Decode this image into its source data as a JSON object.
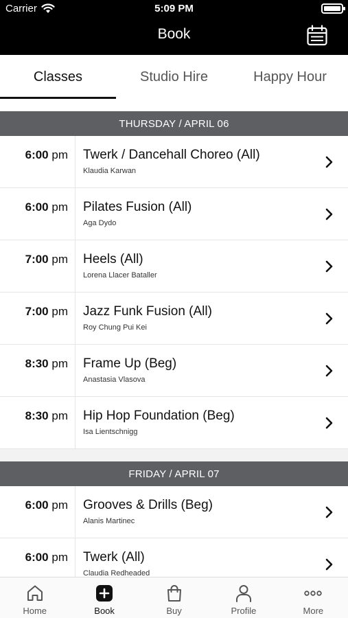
{
  "status_bar": {
    "carrier": "Carrier",
    "time": "5:09 PM"
  },
  "nav": {
    "title": "Book"
  },
  "tabs": [
    {
      "label": "Classes",
      "active": true
    },
    {
      "label": "Studio Hire",
      "active": false
    },
    {
      "label": "Happy Hour",
      "active": false
    }
  ],
  "days": [
    {
      "header": "THURSDAY / APRIL 06",
      "classes": [
        {
          "time": "6:00",
          "ampm": "pm",
          "name": "Twerk / Dancehall Choreo (All)",
          "instructor": "Klaudia Karwan"
        },
        {
          "time": "6:00",
          "ampm": "pm",
          "name": "Pilates Fusion (All)",
          "instructor": "Aga Dydo"
        },
        {
          "time": "7:00",
          "ampm": "pm",
          "name": "Heels (All)",
          "instructor": "Lorena Llacer Bataller"
        },
        {
          "time": "7:00",
          "ampm": "pm",
          "name": "Jazz Funk Fusion (All)",
          "instructor": "Roy Chung Pui Kei"
        },
        {
          "time": "8:30",
          "ampm": "pm",
          "name": "Frame Up (Beg)",
          "instructor": "Anastasia Vlasova"
        },
        {
          "time": "8:30",
          "ampm": "pm",
          "name": "Hip Hop Foundation (Beg)",
          "instructor": "Isa Lientschnigg"
        }
      ]
    },
    {
      "header": "FRIDAY / APRIL 07",
      "classes": [
        {
          "time": "6:00",
          "ampm": "pm",
          "name": "Grooves & Drills (Beg)",
          "instructor": "Alanis Martinec"
        },
        {
          "time": "6:00",
          "ampm": "pm",
          "name": "Twerk (All)",
          "instructor": "Claudia Redheaded"
        }
      ]
    }
  ],
  "tabbar": [
    {
      "label": "Home",
      "icon": "home-icon",
      "active": false
    },
    {
      "label": "Book",
      "icon": "book-plus-icon",
      "active": true
    },
    {
      "label": "Buy",
      "icon": "shopping-bag-icon",
      "active": false
    },
    {
      "label": "Profile",
      "icon": "person-icon",
      "active": false
    },
    {
      "label": "More",
      "icon": "more-dots-icon",
      "active": false
    }
  ]
}
